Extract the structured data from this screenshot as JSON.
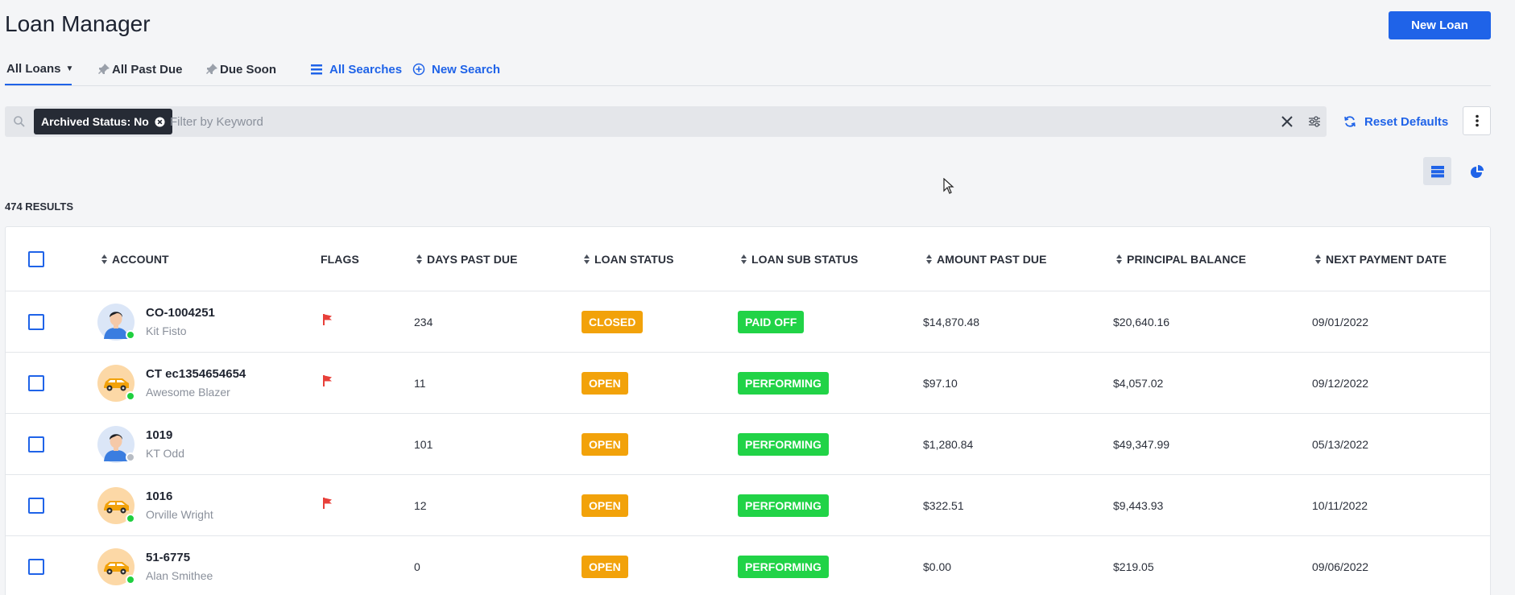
{
  "page": {
    "title": "Loan Manager",
    "new_loan_label": "New Loan"
  },
  "tabs": [
    {
      "label": "All Loans",
      "icon": "pin-icon",
      "active": true,
      "dropdown": true
    },
    {
      "label": "All Past Due",
      "icon": "pin-icon"
    },
    {
      "label": "Due Soon",
      "icon": "pin-icon"
    },
    {
      "label": "All Searches",
      "icon": "list-icon"
    },
    {
      "label": "New Search",
      "icon": "plus-circle-icon"
    }
  ],
  "filter": {
    "chip_label": "Archived Status: No",
    "keyword_placeholder": "Filter by Keyword",
    "keyword_value": "",
    "reset_label": "Reset Defaults"
  },
  "results": {
    "count_label": "474 RESULTS"
  },
  "table": {
    "columns": {
      "account": "ACCOUNT",
      "flags": "FLAGS",
      "days_past_due": "DAYS PAST DUE",
      "loan_status": "LOAN STATUS",
      "loan_sub_status": "LOAN SUB STATUS",
      "amount_past_due": "AMOUNT PAST DUE",
      "principal_balance": "PRINCIPAL BALANCE",
      "next_payment_date": "NEXT PAYMENT DATE"
    },
    "rows": [
      {
        "account_id": "CO-1004251",
        "customer": "Kit Fisto",
        "avatar": "person-avatar-icon",
        "online": true,
        "flag": true,
        "days_past_due": "234",
        "loan_status": "CLOSED",
        "loan_sub_status": "PAID OFF",
        "amount_past_due": "$14,870.48",
        "principal_balance": "$20,640.16",
        "next_payment_date": "09/01/2022"
      },
      {
        "account_id": "CT ec1354654654",
        "customer": "Awesome Blazer",
        "avatar": "car-avatar-icon",
        "online": true,
        "flag": true,
        "days_past_due": "11",
        "loan_status": "OPEN",
        "loan_sub_status": "PERFORMING",
        "amount_past_due": "$97.10",
        "principal_balance": "$4,057.02",
        "next_payment_date": "09/12/2022"
      },
      {
        "account_id": "1019",
        "customer": "KT Odd",
        "avatar": "person-avatar-icon",
        "online": false,
        "flag": false,
        "days_past_due": "101",
        "loan_status": "OPEN",
        "loan_sub_status": "PERFORMING",
        "amount_past_due": "$1,280.84",
        "principal_balance": "$49,347.99",
        "next_payment_date": "05/13/2022"
      },
      {
        "account_id": "1016",
        "customer": "Orville Wright",
        "avatar": "car-avatar-icon",
        "online": true,
        "flag": true,
        "days_past_due": "12",
        "loan_status": "OPEN",
        "loan_sub_status": "PERFORMING",
        "amount_past_due": "$322.51",
        "principal_balance": "$9,443.93",
        "next_payment_date": "10/11/2022"
      },
      {
        "account_id": "51-6775",
        "customer": "Alan Smithee",
        "avatar": "car-avatar-icon",
        "online": true,
        "flag": false,
        "days_past_due": "0",
        "loan_status": "OPEN",
        "loan_sub_status": "PERFORMING",
        "amount_past_due": "$0.00",
        "principal_balance": "$219.05",
        "next_payment_date": "09/06/2022"
      }
    ]
  },
  "colors": {
    "primary": "#1f63e8",
    "status_closed": "#f2a20a",
    "status_open": "#f2a20a",
    "sub_status_green": "#21d347",
    "flag_red": "#e8403a",
    "online_green": "#1fcf3f",
    "offline_gray": "#b7bcc4"
  }
}
